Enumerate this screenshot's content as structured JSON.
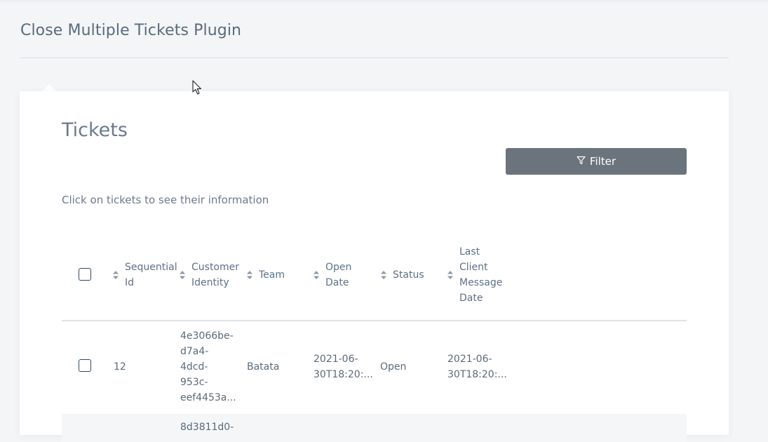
{
  "page": {
    "title": "Close Multiple Tickets Plugin"
  },
  "card": {
    "title": "Tickets",
    "hint": "Click on tickets to see their information",
    "filter_label": "Filter"
  },
  "table": {
    "columns": [
      {
        "label_lines": [
          "Sequential",
          "Id"
        ]
      },
      {
        "label_lines": [
          "Customer",
          "Identity"
        ]
      },
      {
        "label_lines": [
          "Team"
        ]
      },
      {
        "label_lines": [
          "Open",
          "Date"
        ]
      },
      {
        "label_lines": [
          "Status"
        ]
      },
      {
        "label_lines": [
          "Last",
          "Client",
          "Message",
          "Date"
        ]
      }
    ],
    "rows": [
      {
        "sequential_id": "12",
        "customer_identity_lines": [
          "4e3066be-",
          "d7a4-",
          "4dcd-",
          "953c-",
          "eef4453a..."
        ],
        "team": "Batata",
        "open_date_lines": [
          "2021-06-",
          "30T18:20:..."
        ],
        "status": "Open",
        "last_client_message_date_lines": [
          "2021-06-",
          "30T18:20:..."
        ]
      },
      {
        "customer_identity_lines": [
          "8d3811d0-"
        ]
      }
    ]
  },
  "colors": {
    "filter_button": "#6b747c",
    "checkbox_border": "#2d4a66"
  },
  "icons": {
    "filter": "funnel-icon",
    "sort": "sort-arrows-icon",
    "cursor": "mouse-pointer-icon"
  }
}
